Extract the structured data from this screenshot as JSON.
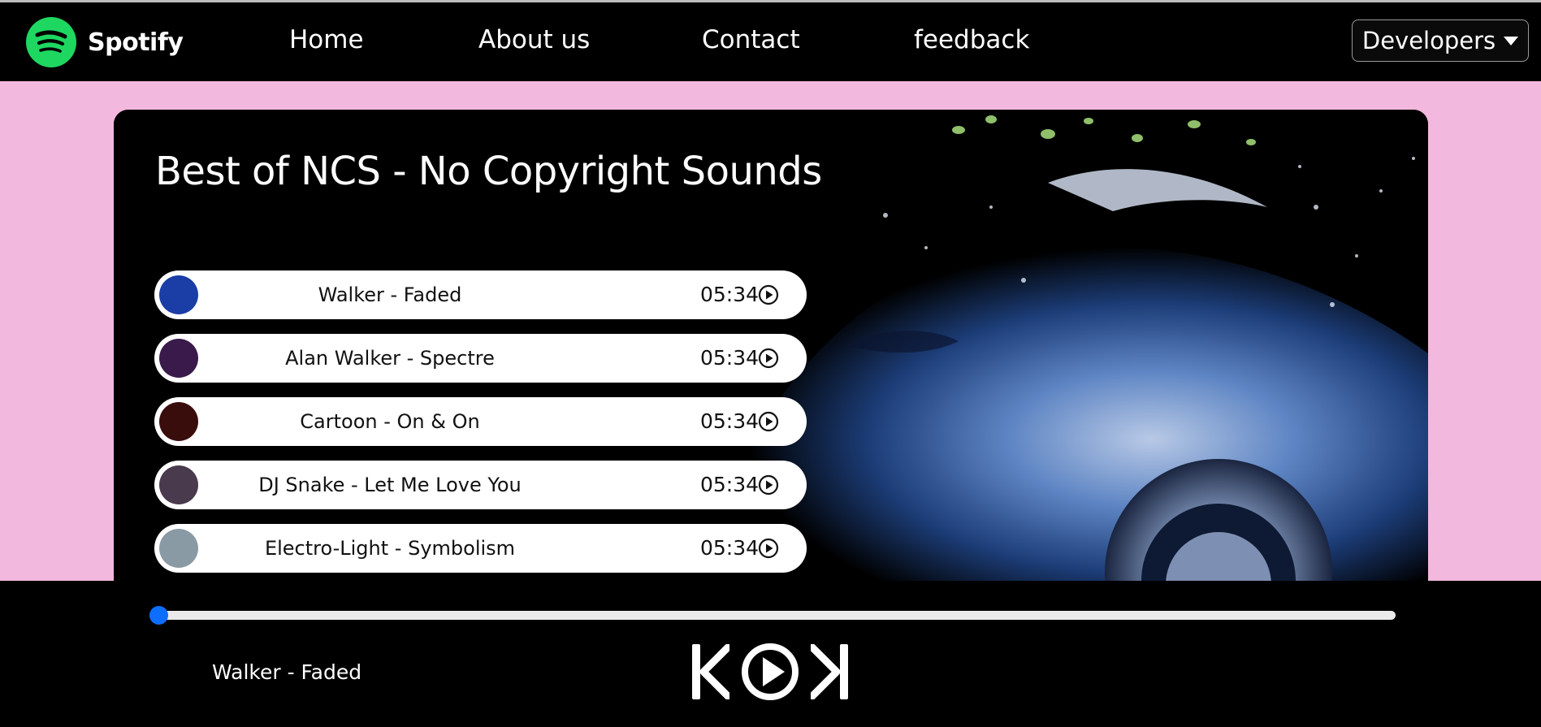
{
  "brand": {
    "name": "Spotify",
    "logo_icon": "spotify-logo-icon",
    "logo_color": "#1ed760"
  },
  "nav": {
    "links": [
      "Home",
      "About us",
      "Contact",
      "feedback"
    ],
    "dropdown_label": "Developers",
    "dropdown_icon": "caret-down-icon"
  },
  "playlist": {
    "title": "Best of NCS - No Copyright Sounds",
    "songs": [
      {
        "name": "Walker - Faded",
        "duration": "05:34",
        "cover_color": "#1b3da6"
      },
      {
        "name": "Alan Walker - Spectre",
        "duration": "05:34",
        "cover_color": "#3a1a4a"
      },
      {
        "name": "Cartoon - On & On",
        "duration": "05:34",
        "cover_color": "#3a0d0d"
      },
      {
        "name": "DJ Snake - Let Me Love You",
        "duration": "05:34",
        "cover_color": "#4a3a4e"
      },
      {
        "name": "Electro-Light - Symbolism",
        "duration": "05:34",
        "cover_color": "#8a9aa4"
      }
    ],
    "play_icon": "play-circle-icon"
  },
  "player": {
    "now_playing": "Walker - Faded",
    "progress": 0,
    "accent_color": "#0d6efd",
    "controls": [
      "previous-icon",
      "play-icon",
      "next-icon"
    ]
  },
  "colors": {
    "page_background": "#f3b8dd",
    "navbar": "#000000"
  }
}
